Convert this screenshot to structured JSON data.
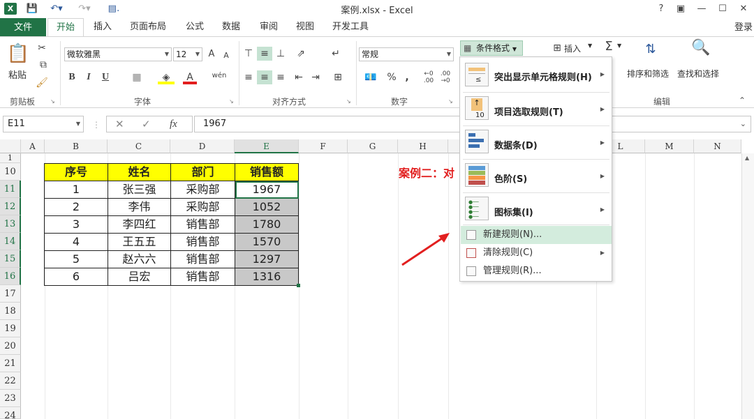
{
  "app": {
    "title": "案例.xlsx - Excel",
    "logo": "X",
    "help": "?",
    "login": "登录"
  },
  "tabs": [
    "文件",
    "开始",
    "插入",
    "页面布局",
    "公式",
    "数据",
    "审阅",
    "视图",
    "开发工具"
  ],
  "ribbon": {
    "paste": "粘贴",
    "clipboard": "剪贴板",
    "font_name": "微软雅黑",
    "font_size": "12",
    "font_group": "字体",
    "align_group": "对齐方式",
    "number_format": "常规",
    "number_group": "数字",
    "conditional_format": "条件格式",
    "insert": "插入",
    "sort_filter": "排序和筛选",
    "find_select": "查找和选择",
    "edit_group": "编辑",
    "bold": "B",
    "italic": "I",
    "underline": "U",
    "grow_font": "A",
    "shrink_font": "A",
    "font_color": "A",
    "wen": "wén",
    "percent": "%",
    "comma": ","
  },
  "formula_bar": {
    "name_box": "E11",
    "fx": "fx",
    "value": "1967"
  },
  "grid": {
    "columns": [
      "A",
      "B",
      "C",
      "D",
      "E",
      "F",
      "G",
      "H",
      "L",
      "M",
      "N"
    ],
    "rows": [
      "1",
      "10",
      "11",
      "12",
      "13",
      "14",
      "15",
      "16",
      "17",
      "18",
      "19",
      "20",
      "21",
      "22",
      "23",
      "24"
    ],
    "table_headers": [
      "序号",
      "姓名",
      "部门",
      "销售额"
    ],
    "table_rows": [
      [
        "1",
        "张三强",
        "采购部",
        "1967"
      ],
      [
        "2",
        "李伟",
        "采购部",
        "1052"
      ],
      [
        "3",
        "李四红",
        "销售部",
        "1780"
      ],
      [
        "4",
        "王五五",
        "销售部",
        "1570"
      ],
      [
        "5",
        "赵六六",
        "销售部",
        "1297"
      ],
      [
        "6",
        "吕宏",
        "销售部",
        "1316"
      ]
    ],
    "annotation": "案例二：对"
  },
  "dropdown": {
    "items": [
      "突出显示单元格规则(H)",
      "项目选取规则(T)",
      "数据条(D)",
      "色阶(S)",
      "图标集(I)"
    ],
    "small_items": [
      "新建规则(N)...",
      "清除规则(C)",
      "管理规则(R)..."
    ]
  },
  "colors": {
    "excel_green": "#217346",
    "highlight_yellow": "#ffff00",
    "selected_grey": "#c8c8c8",
    "annotation_red": "#e21f1f"
  }
}
